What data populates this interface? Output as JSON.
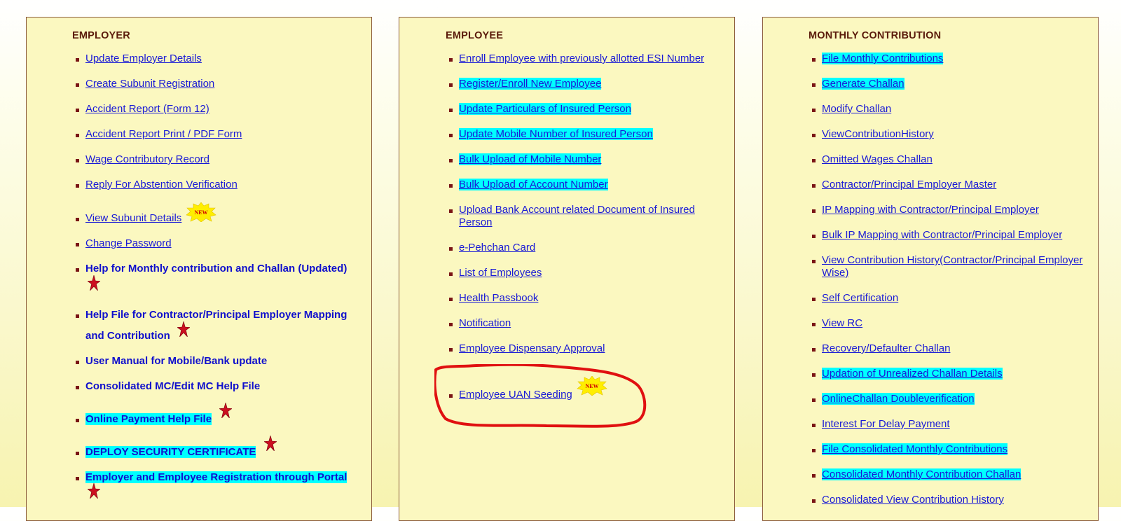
{
  "employer": {
    "title": "EMPLOYER",
    "items": [
      "Update Employer Details",
      "Create Subunit Registration",
      "Accident Report (Form 12)",
      "Accident Report Print / PDF Form",
      "Wage Contributory Record",
      "Reply For Abstention Verification",
      "View Subunit Details",
      "Change Password",
      "Help for Monthly contribution and Challan (Updated)",
      "Help File for Contractor/Principal Employer Mapping",
      "and Contribution",
      "User Manual for Mobile/Bank update",
      "Consolidated MC/Edit MC Help File",
      "Online Payment Help File",
      "DEPLOY SECURITY CERTIFICATE",
      "Employer and Employee Registration through Portal"
    ]
  },
  "employee": {
    "title": "EMPLOYEE",
    "items": [
      "Enroll Employee with previously allotted ESI Number",
      "Register/Enroll New Employee",
      "Update Particulars of Insured Person",
      "Update Mobile Number of Insured Person",
      "Bulk Upload of Mobile Number",
      "Bulk Upload of Account Number",
      "Upload Bank Account related Document of Insured",
      "Person",
      "e-Pehchan Card",
      "List of Employees",
      "Health Passbook",
      "Notification",
      "Employee Dispensary Approval",
      "Employee UAN Seeding"
    ]
  },
  "monthly": {
    "title": "MONTHLY CONTRIBUTION",
    "items": [
      "File Monthly Contributions",
      "Generate Challan",
      "Modify Challan",
      "ViewContributionHistory",
      "Omitted Wages Challan",
      "Contractor/Principal Employer Master",
      "IP Mapping with Contractor/Principal Employer",
      "Bulk IP Mapping with Contractor/Principal Employer",
      "View Contribution History(Contractor/Principal Employer",
      "Wise)",
      "Self Certification",
      "View RC",
      "Recovery/Defaulter Challan",
      "Updation of Unrealized Challan Details",
      "OnlineChallan Doubleverification",
      "Interest For Delay Payment",
      "File Consolidated Monthly Contributions",
      "Consolidated Monthly Contribution Challan",
      "Consolidated View Contribution History"
    ]
  },
  "badge": {
    "text": "NEW"
  },
  "colors": {
    "highlight": "#00ffff",
    "link": "#1a1ad6",
    "panel": "#fbf8c0",
    "title": "#5a1a0a"
  },
  "icons": [
    "red-star-icon",
    "new-badge-icon"
  ]
}
